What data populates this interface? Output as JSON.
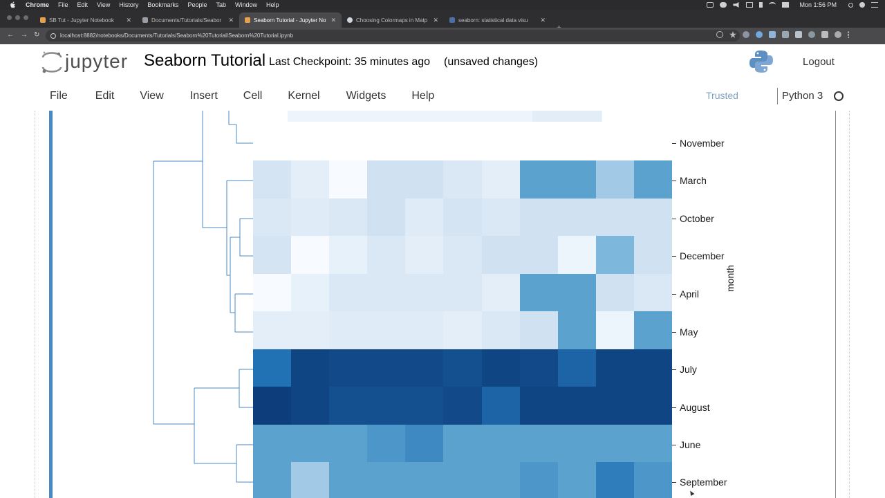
{
  "menubar": {
    "app_name": "Chrome",
    "items": [
      "File",
      "Edit",
      "View",
      "History",
      "Bookmarks",
      "People",
      "Tab",
      "Window",
      "Help"
    ],
    "clock": "Mon 1:56 PM"
  },
  "browser": {
    "tabs": [
      {
        "title": "SB Tut - Jupyter Notebook",
        "active": false
      },
      {
        "title": "Documents/Tutorials/Seabor",
        "active": false
      },
      {
        "title": "Seaborn Tutorial - Jupyter Not",
        "active": true
      },
      {
        "title": "Choosing Colormaps in Matp",
        "active": false
      },
      {
        "title": "seaborn: statistical data visu",
        "active": false
      }
    ],
    "url": "localhost:8882/notebooks/Documents/Tutorials/Seaborn%20Tutorial/Seaborn%20Tutorial.ipynb"
  },
  "header": {
    "logo_text": "jupyter",
    "notebook_title": "Seaborn Tutorial",
    "checkpoint": "Last Checkpoint: 35 minutes ago",
    "unsaved": "(unsaved changes)",
    "logout": "Logout"
  },
  "menu": {
    "items": [
      "File",
      "Edit",
      "View",
      "Insert",
      "Cell",
      "Kernel",
      "Widgets",
      "Help"
    ],
    "trusted": "Trusted",
    "kernel": "Python 3"
  },
  "heatmap": {
    "y_axis_label": "month",
    "row_labels": [
      "November",
      "March",
      "October",
      "December",
      "April",
      "May",
      "July",
      "August",
      "June",
      "September"
    ],
    "colormap": "Blues",
    "rows": [
      [
        0.18,
        0.1,
        0.0,
        0.2,
        0.2,
        0.15,
        0.1,
        0.55,
        0.55,
        0.35,
        0.55
      ],
      [
        0.15,
        0.12,
        0.15,
        0.2,
        0.12,
        0.18,
        0.15,
        0.2,
        0.2,
        0.2,
        0.2
      ],
      [
        0.18,
        0.0,
        0.08,
        0.15,
        0.1,
        0.15,
        0.2,
        0.2,
        0.05,
        0.45,
        0.2
      ],
      [
        0.0,
        0.08,
        0.15,
        0.15,
        0.15,
        0.15,
        0.1,
        0.55,
        0.55,
        0.2,
        0.15
      ],
      [
        0.1,
        0.1,
        0.12,
        0.12,
        0.12,
        0.1,
        0.15,
        0.2,
        0.55,
        0.05,
        0.55
      ],
      [
        0.75,
        0.92,
        0.9,
        0.9,
        0.9,
        0.88,
        0.92,
        0.9,
        0.8,
        0.92,
        0.92
      ],
      [
        0.95,
        0.92,
        0.88,
        0.88,
        0.88,
        0.9,
        0.8,
        0.92,
        0.92,
        0.92,
        0.92
      ],
      [
        0.55,
        0.55,
        0.55,
        0.6,
        0.65,
        0.55,
        0.55,
        0.55,
        0.55,
        0.55,
        0.55
      ],
      [
        0.55,
        0.35,
        0.55,
        0.55,
        0.55,
        0.55,
        0.55,
        0.6,
        0.55,
        0.7,
        0.6
      ]
    ]
  }
}
